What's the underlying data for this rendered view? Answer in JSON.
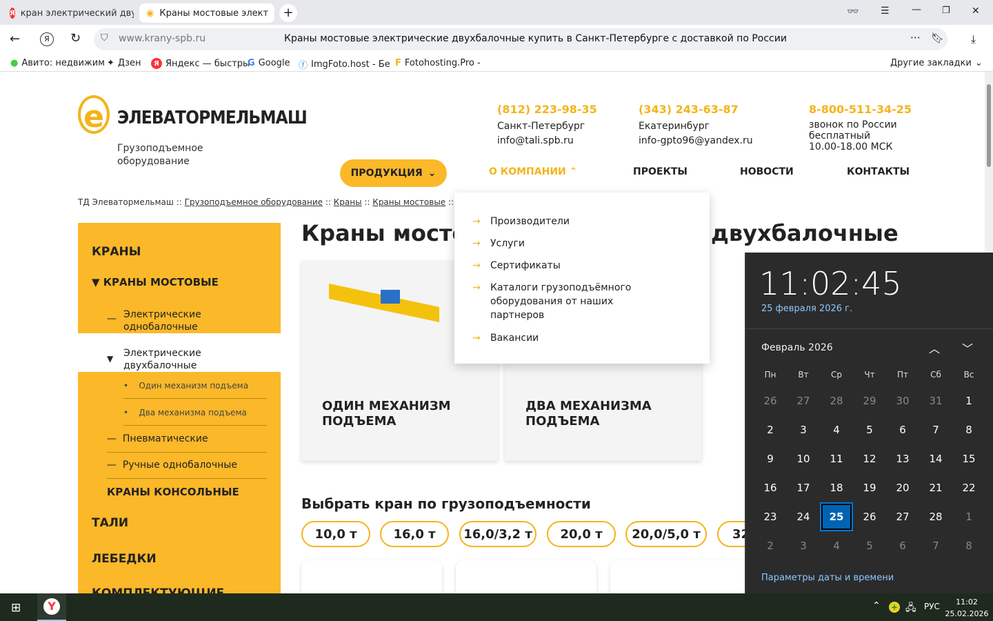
{
  "browser": {
    "tabs": [
      {
        "title": "кран электрический двух"
      },
      {
        "title": "Краны мостовые элект"
      }
    ],
    "url": "www.krany-spb.ru",
    "page_title": "Краны мостовые электрические двухбалочные купить в Санкт-Петербурге с доставкой по России",
    "bookmarks": [
      "Авито: недвижим",
      "Дзен",
      "Яндекс — быстры",
      "Google",
      "ImgFoto.host - Бе",
      "Fotohosting.Pro - "
    ],
    "other_bookmarks": "Другие закладки"
  },
  "site": {
    "logo": "ЭЛЕВАТОРМЕЛЬМАШ",
    "tagline": "Грузоподъемное оборудование",
    "contacts": [
      {
        "phone": "(812) 223-98-35",
        "l1": "Санкт-Петербург",
        "l2": "info@tali.spb.ru"
      },
      {
        "phone": "(343) 243-63-87",
        "l1": "Екатеринбург",
        "l2": "info-gpto96@yandex.ru"
      },
      {
        "phone": "8-800-511-34-25",
        "l1": "звонок по России бесплатный",
        "l2": "10.00-18.00 МСК"
      }
    ],
    "nav": {
      "products": "ПРОДУКЦИЯ",
      "about": "О КОМПАНИИ",
      "projects": "ПРОЕКТЫ",
      "news": "НОВОСТИ",
      "contacts": "КОНТАКТЫ"
    },
    "breadcrumb": [
      "ТД Элеватормельмаш",
      "Грузоподъемное оборудование",
      "Краны",
      "Краны мостовые"
    ],
    "about_menu": [
      "Производители",
      "Услуги",
      "Сертификаты",
      "Каталоги грузоподъёмного оборудования от наших партнеров",
      "Вакансии"
    ],
    "sidebar": {
      "cranes": "КРАНЫ",
      "bridge": "КРАНЫ МОСТОВЫЕ",
      "el_single": "Электрические однобалочные",
      "el_double": "Электрические двухбалочные",
      "one_mech": "Один механизм подъема",
      "two_mech": "Два механизма подъема",
      "pneumo": "Пневматические",
      "manual": "Ручные однобалочные",
      "console": "КРАНЫ КОНСОЛЬНЫЕ",
      "hoists": "ТАЛИ",
      "winches": "ЛЕБЕДКИ",
      "parts": "КОМПЛЕКТУЮЩИЕ"
    },
    "title": "Краны мостовые электрические двухбалочные",
    "title_left": "Краны мосто",
    "title_right": "двухбалочные",
    "cards": [
      "ОДИН МЕХАНИЗМ ПОДЪЕМА",
      "ДВА МЕХАНИЗМА ПОДЪЕМА"
    ],
    "capacity_title": "Выбрать кран по грузоподъемности",
    "capacities": [
      "10,0 т",
      "16,0 т",
      "16,0/3,2 т",
      "20,0 т",
      "20,0/5,0 т",
      "32"
    ]
  },
  "calendar": {
    "time": "11:02:45",
    "date": "25 февраля 2026 г.",
    "month": "Февраль 2026",
    "weekdays": [
      "Пн",
      "Вт",
      "Ср",
      "Чт",
      "Пт",
      "Сб",
      "Вс"
    ],
    "days": [
      26,
      27,
      28,
      29,
      30,
      31,
      1,
      2,
      3,
      4,
      5,
      6,
      7,
      8,
      9,
      10,
      11,
      12,
      13,
      14,
      15,
      16,
      17,
      18,
      19,
      20,
      21,
      22,
      23,
      24,
      25,
      26,
      27,
      28,
      1,
      2,
      3,
      4,
      5,
      6,
      7,
      8
    ],
    "first_current_index": 6,
    "last_current_index": 33,
    "today_index": 30,
    "settings": "Параметры даты и времени"
  },
  "taskbar": {
    "lang": "РУС",
    "time": "11:02",
    "date": "25.02.2026"
  },
  "colors": {
    "accent": "#f4b41a",
    "sidebar": "#fbb829",
    "calendar_bg": "#2b2b2b",
    "today": "#0063b1"
  }
}
